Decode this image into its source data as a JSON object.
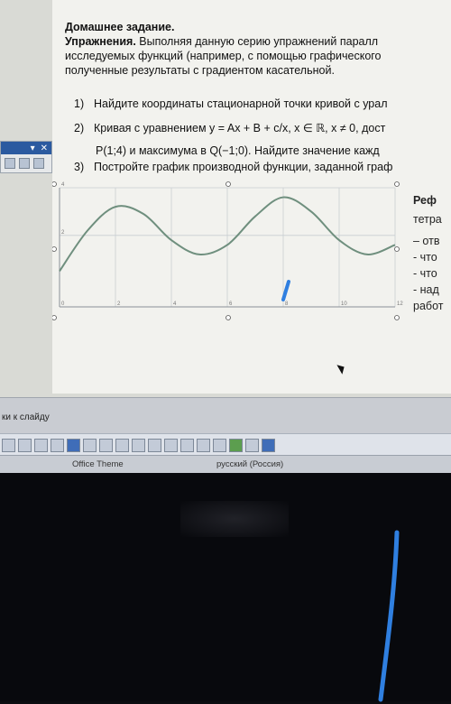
{
  "slide": {
    "title": "Домашнее задание.",
    "paragraph_bold": "Упражнения.",
    "paragraph_line1": " Выполняя данную серию упражнений паралл",
    "paragraph_line2": "исследуемых функций (например, с помощью графического",
    "paragraph_line3": "полученные результаты с градиентом касательной.",
    "tasks": [
      {
        "num": "1)",
        "text": "Найдите координаты стационарной точки кривой с урал"
      },
      {
        "num": "2)",
        "text": "Кривая с уравнением y = Ax + B + c/x, x ∈ ℝ, x ≠ 0, дост"
      },
      {
        "num": "",
        "text": "P(1;4) и максимума в Q(−1;0). Найдите значение кажд"
      },
      {
        "num": "3)",
        "text": "Постройте график производной функции, заданной граф"
      }
    ],
    "side_text": [
      "Реф",
      "тетра",
      "– отв",
      "- что",
      "- что",
      "- над",
      "работ"
    ]
  },
  "mini_panel": {
    "arrow": "▾",
    "close": "✕"
  },
  "chart_data": {
    "type": "line",
    "x_ticks": [
      "0",
      "2",
      "4",
      "6",
      "8",
      "10",
      "12"
    ],
    "y_ticks": [
      "4",
      "2"
    ],
    "xlim": [
      0,
      12
    ],
    "ylim": [
      -1,
      4
    ],
    "series": [
      {
        "x": [
          0,
          1,
          2,
          3,
          4,
          5,
          6,
          7,
          8,
          9,
          10,
          11,
          12
        ],
        "y": [
          0.5,
          2.2,
          3.2,
          2.9,
          1.8,
          1.2,
          1.6,
          2.8,
          3.6,
          3.0,
          1.8,
          1.2,
          1.6
        ]
      }
    ],
    "grid": true
  },
  "notes": {
    "label": "ки к слайду"
  },
  "status": {
    "theme": "Office Theme",
    "language": "русский (Россия)"
  },
  "colors": {
    "curve": "#6f8f7e",
    "pen": "#2f7fe0"
  }
}
